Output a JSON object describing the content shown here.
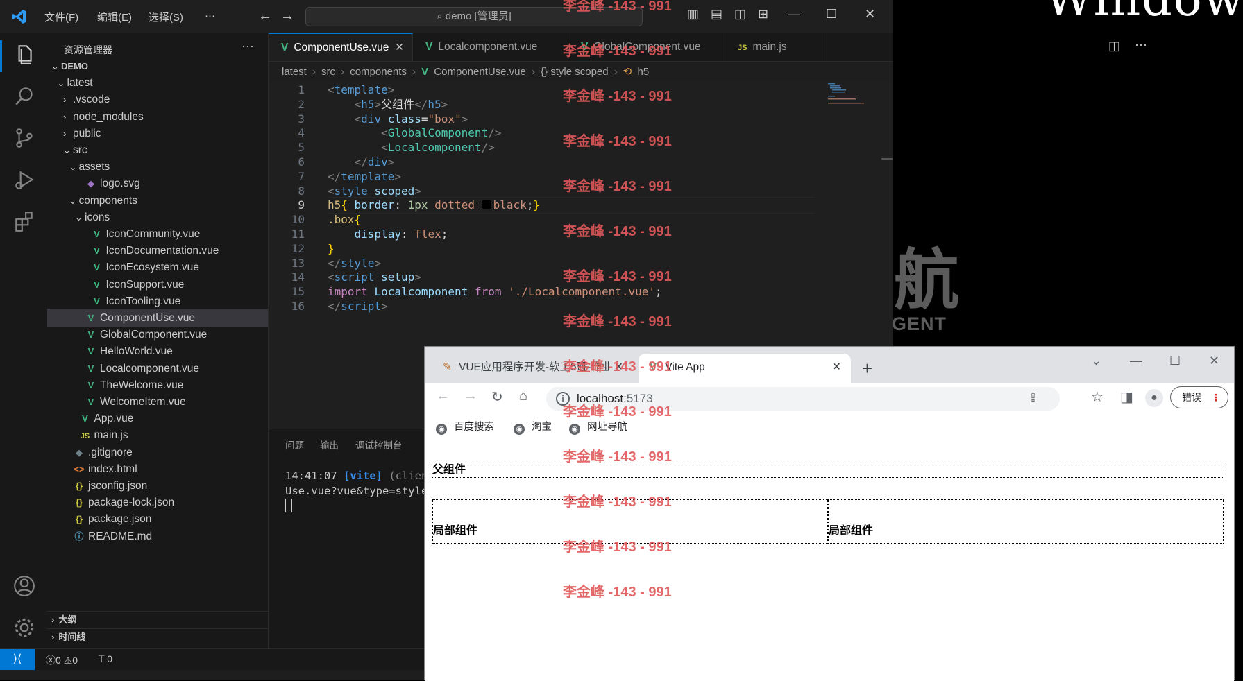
{
  "desktop": {
    "text": "Windows",
    "logo_char": "航",
    "logo_sub": "GENT"
  },
  "vscode": {
    "menu": [
      "文件(F)",
      "编辑(E)",
      "选择(S)",
      "···"
    ],
    "command_center": "demo [管理员]",
    "sidebar_title": "资源管理器",
    "sidebar_more": "···",
    "tree": [
      {
        "label": "DEMO",
        "depth": 0,
        "chev": "⌄",
        "icon": "",
        "bold": true
      },
      {
        "label": "latest",
        "depth": 1,
        "chev": "⌄",
        "icon": ""
      },
      {
        "label": ".vscode",
        "depth": 2,
        "chev": "›",
        "icon": ""
      },
      {
        "label": "node_modules",
        "depth": 2,
        "chev": "›",
        "icon": ""
      },
      {
        "label": "public",
        "depth": 2,
        "chev": "›",
        "icon": ""
      },
      {
        "label": "src",
        "depth": 2,
        "chev": "⌄",
        "icon": ""
      },
      {
        "label": "assets",
        "depth": 3,
        "chev": "⌄",
        "icon": ""
      },
      {
        "label": "logo.svg",
        "depth": 4,
        "chev": "",
        "icon": "svg"
      },
      {
        "label": "components",
        "depth": 3,
        "chev": "⌄",
        "icon": ""
      },
      {
        "label": "icons",
        "depth": 4,
        "chev": "⌄",
        "icon": ""
      },
      {
        "label": "IconCommunity.vue",
        "depth": 5,
        "chev": "",
        "icon": "vue"
      },
      {
        "label": "IconDocumentation.vue",
        "depth": 5,
        "chev": "",
        "icon": "vue"
      },
      {
        "label": "IconEcosystem.vue",
        "depth": 5,
        "chev": "",
        "icon": "vue"
      },
      {
        "label": "IconSupport.vue",
        "depth": 5,
        "chev": "",
        "icon": "vue"
      },
      {
        "label": "IconTooling.vue",
        "depth": 5,
        "chev": "",
        "icon": "vue"
      },
      {
        "label": "ComponentUse.vue",
        "depth": 4,
        "chev": "",
        "icon": "vue",
        "selected": true
      },
      {
        "label": "GlobalComponent.vue",
        "depth": 4,
        "chev": "",
        "icon": "vue"
      },
      {
        "label": "HelloWorld.vue",
        "depth": 4,
        "chev": "",
        "icon": "vue"
      },
      {
        "label": "Localcomponent.vue",
        "depth": 4,
        "chev": "",
        "icon": "vue"
      },
      {
        "label": "TheWelcome.vue",
        "depth": 4,
        "chev": "",
        "icon": "vue"
      },
      {
        "label": "WelcomeItem.vue",
        "depth": 4,
        "chev": "",
        "icon": "vue"
      },
      {
        "label": "App.vue",
        "depth": 3,
        "chev": "",
        "icon": "vue"
      },
      {
        "label": "main.js",
        "depth": 3,
        "chev": "",
        "icon": "js"
      },
      {
        "label": ".gitignore",
        "depth": 2,
        "chev": "",
        "icon": "git"
      },
      {
        "label": "index.html",
        "depth": 2,
        "chev": "",
        "icon": "html"
      },
      {
        "label": "jsconfig.json",
        "depth": 2,
        "chev": "",
        "icon": "json"
      },
      {
        "label": "package-lock.json",
        "depth": 2,
        "chev": "",
        "icon": "json"
      },
      {
        "label": "package.json",
        "depth": 2,
        "chev": "",
        "icon": "json"
      },
      {
        "label": "README.md",
        "depth": 2,
        "chev": "",
        "icon": "md"
      }
    ],
    "sections": [
      "大纲",
      "时间线"
    ],
    "tabs": [
      {
        "label": "ComponentUse.vue",
        "icon": "vue",
        "active": true,
        "close": "✕"
      },
      {
        "label": "Localcomponent.vue",
        "icon": "vue",
        "active": false,
        "close": ""
      },
      {
        "label": "GlobalComponent.vue",
        "icon": "vue",
        "active": false,
        "close": ""
      },
      {
        "label": "main.js",
        "icon": "js",
        "active": false,
        "close": ""
      }
    ],
    "breadcrumb": [
      "latest",
      "src",
      "components",
      "ComponentUse.vue",
      "{} style scoped",
      "h5"
    ],
    "current_line": 9,
    "code_lines": [
      [
        [
          "tk-brk",
          "<"
        ],
        [
          "tk-tag",
          "template"
        ],
        [
          "tk-brk",
          ">"
        ]
      ],
      [
        [
          "tk-txt",
          "    "
        ],
        [
          "tk-brk",
          "<"
        ],
        [
          "tk-tag",
          "h5"
        ],
        [
          "tk-brk",
          ">"
        ],
        [
          "tk-txt",
          "父组件"
        ],
        [
          "tk-brk",
          "</"
        ],
        [
          "tk-tag",
          "h5"
        ],
        [
          "tk-brk",
          ">"
        ]
      ],
      [
        [
          "tk-txt",
          "    "
        ],
        [
          "tk-brk",
          "<"
        ],
        [
          "tk-tag",
          "div"
        ],
        [
          "tk-txt",
          " "
        ],
        [
          "tk-attr",
          "class"
        ],
        [
          "tk-txt",
          "="
        ],
        [
          "tk-str",
          "\"box\""
        ],
        [
          "tk-brk",
          ">"
        ]
      ],
      [
        [
          "tk-txt",
          "        "
        ],
        [
          "tk-brk",
          "<"
        ],
        [
          "tk-comp",
          "GlobalComponent"
        ],
        [
          "tk-brk",
          "/>"
        ]
      ],
      [
        [
          "tk-txt",
          "        "
        ],
        [
          "tk-brk",
          "<"
        ],
        [
          "tk-comp",
          "Localcomponent"
        ],
        [
          "tk-brk",
          "/>"
        ]
      ],
      [
        [
          "tk-txt",
          "    "
        ],
        [
          "tk-brk",
          "</"
        ],
        [
          "tk-tag",
          "div"
        ],
        [
          "tk-brk",
          ">"
        ]
      ],
      [
        [
          "tk-brk",
          "</"
        ],
        [
          "tk-tag",
          "template"
        ],
        [
          "tk-brk",
          ">"
        ]
      ],
      [
        [
          "tk-brk",
          "<"
        ],
        [
          "tk-tag",
          "style"
        ],
        [
          "tk-txt",
          " "
        ],
        [
          "tk-attr",
          "scoped"
        ],
        [
          "tk-brk",
          ">"
        ]
      ],
      [
        [
          "tk-sel",
          "h5"
        ],
        [
          "tk-br1",
          "{"
        ],
        [
          "tk-txt",
          " "
        ],
        [
          "tk-attr",
          "border"
        ],
        [
          "tk-txt",
          ": "
        ],
        [
          "tk-num",
          "1px"
        ],
        [
          "tk-txt",
          " "
        ],
        [
          "tk-str",
          "dotted"
        ],
        [
          "tk-txt",
          " "
        ],
        [
          "colorbox",
          ""
        ],
        [
          "tk-str",
          "black"
        ],
        [
          "tk-txt",
          ";"
        ],
        [
          "tk-br1",
          "}"
        ]
      ],
      [
        [
          "tk-sel",
          ".box"
        ],
        [
          "tk-br1",
          "{"
        ]
      ],
      [
        [
          "tk-txt",
          "    "
        ],
        [
          "tk-attr",
          "display"
        ],
        [
          "tk-txt",
          ": "
        ],
        [
          "tk-str",
          "flex"
        ],
        [
          "tk-txt",
          ";"
        ]
      ],
      [
        [
          "tk-br1",
          "}"
        ]
      ],
      [
        [
          "tk-brk",
          "</"
        ],
        [
          "tk-tag",
          "style"
        ],
        [
          "tk-brk",
          ">"
        ]
      ],
      [
        [
          "tk-brk",
          "<"
        ],
        [
          "tk-tag",
          "script"
        ],
        [
          "tk-txt",
          " "
        ],
        [
          "tk-attr",
          "setup"
        ],
        [
          "tk-brk",
          ">"
        ]
      ],
      [
        [
          "tk-kw",
          "import"
        ],
        [
          "tk-txt",
          " "
        ],
        [
          "tk-attr",
          "Localcomponent"
        ],
        [
          "tk-txt",
          " "
        ],
        [
          "tk-kw",
          "from"
        ],
        [
          "tk-txt",
          " "
        ],
        [
          "tk-str",
          "'./Localcomponent.vue'"
        ],
        [
          "tk-txt",
          ";"
        ]
      ],
      [
        [
          "tk-brk",
          "</"
        ],
        [
          "tk-tag",
          "script"
        ],
        [
          "tk-brk",
          ">"
        ]
      ]
    ],
    "panel_tabs": [
      "问题",
      "输出",
      "调试控制台"
    ],
    "terminal": {
      "time": "14:41:07",
      "tag": "[vite]",
      "rest": " (clien",
      "line2": "Use.vue?vue&type=style"
    },
    "status": {
      "errors": "0",
      "warnings": "0",
      "ports": "0"
    }
  },
  "browser": {
    "tabs": [
      {
        "label": "VUE应用程序开发-软工5班-作业",
        "active": false
      },
      {
        "label": "Vite App",
        "active": true
      }
    ],
    "new_tab": "+",
    "url_host": "localhost",
    "url_port": ":5173",
    "error_label": "错误",
    "bookmarks": [
      "百度搜索",
      "淘宝",
      "网址导航"
    ],
    "page": {
      "parent_heading": "父组件",
      "local_1": "局部组件",
      "local_2": "局部组件"
    }
  },
  "watermark": "李金峰 -143 - 991",
  "colors": {
    "accent": "#0078d4",
    "vue_green": "#41b883",
    "watermark": "#e0585a"
  }
}
